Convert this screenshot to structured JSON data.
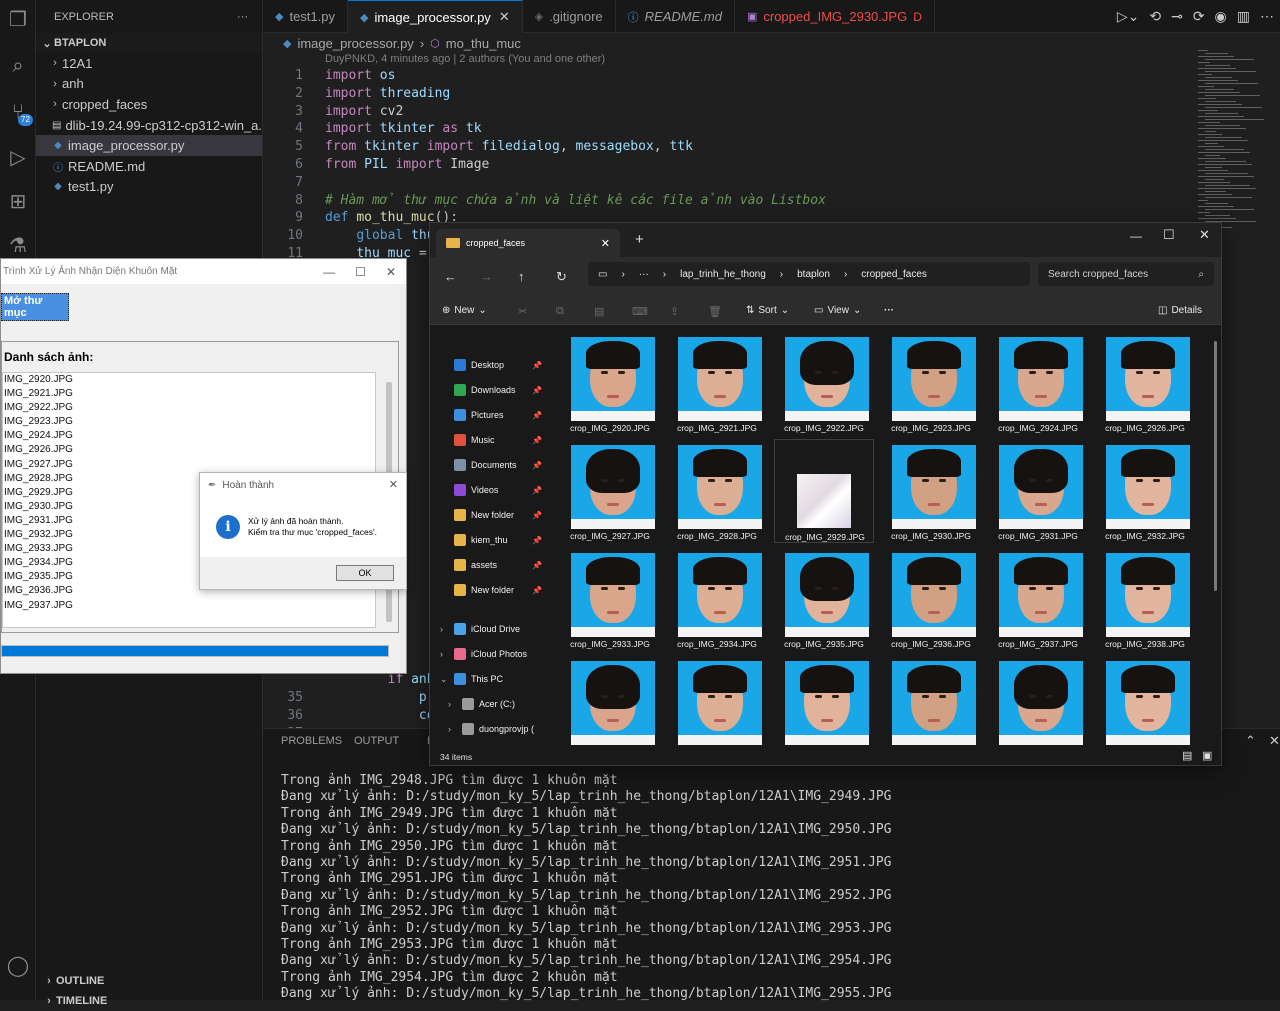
{
  "activity": {
    "scm_badge": "72"
  },
  "sidebar": {
    "header": "EXPLORER",
    "more": "···",
    "project": "BTAPLON",
    "items": [
      {
        "label": "12A1",
        "kind": "folder"
      },
      {
        "label": "anh",
        "kind": "folder"
      },
      {
        "label": "cropped_faces",
        "kind": "folder"
      },
      {
        "label": "dlib-19.24.99-cp312-cp312-win_a...",
        "kind": "file"
      },
      {
        "label": "image_processor.py",
        "kind": "py"
      },
      {
        "label": "README.md",
        "kind": "md"
      },
      {
        "label": "test1.py",
        "kind": "py"
      }
    ],
    "outline": "OUTLINE",
    "timeline": "TIMELINE"
  },
  "tabs": [
    {
      "label": "test1.py",
      "icon": "python-icon"
    },
    {
      "label": "image_processor.py",
      "icon": "python-icon"
    },
    {
      "label": ".gitignore",
      "icon": "git-icon"
    },
    {
      "label": "README.md",
      "icon": "info-icon"
    },
    {
      "label": "cropped_IMG_2930.JPG",
      "icon": "image-icon",
      "suffix": "D"
    }
  ],
  "breadcrumb": {
    "file": "image_processor.py",
    "symbol": "mo_thu_muc"
  },
  "blame": "DuyPNKD, 4 minutes ago | 2 authors (You and one other)",
  "code": [
    {
      "n": "1",
      "t": "import os"
    },
    {
      "n": "2",
      "t": "import threading"
    },
    {
      "n": "3",
      "t": "import cv2"
    },
    {
      "n": "4",
      "t": "import tkinter as tk"
    },
    {
      "n": "5",
      "t": "from tkinter import filedialog, messagebox, ttk"
    },
    {
      "n": "6",
      "t": "from PIL import Image"
    },
    {
      "n": "7",
      "t": ""
    },
    {
      "n": "8",
      "t": "# Hàm mở thư mục chứa ảnh và liệt kê các file ảnh vào Listbox"
    },
    {
      "n": "9",
      "t": "def mo_thu_muc():"
    },
    {
      "n": "10",
      "t": "    global thu"
    },
    {
      "n": "11",
      "t": "    thu_muc = "
    }
  ],
  "code_tail": [
    {
      "n": "35",
      "t": "            pr"
    },
    {
      "n": "36",
      "t": "            co"
    },
    {
      "n": "37",
      "t": ""
    }
  ],
  "code_tail_if": {
    "n": "34",
    "t": "        if anh"
  },
  "panel": {
    "tabs": [
      "PROBLEMS",
      "OUTPUT",
      "DE"
    ],
    "lines": [
      "Trong ảnh IMG_2948.JPG tìm được 1 khuôn mặt",
      "Đang xử lý ảnh: D:/study/mon_ky_5/lap_trinh_he_thong/btaplon/12A1\\IMG_2949.JPG",
      "Trong ảnh IMG_2949.JPG tìm được 1 khuôn mặt",
      "Đang xử lý ảnh: D:/study/mon_ky_5/lap_trinh_he_thong/btaplon/12A1\\IMG_2950.JPG",
      "Trong ảnh IMG_2950.JPG tìm được 1 khuôn mặt",
      "Đang xử lý ảnh: D:/study/mon_ky_5/lap_trinh_he_thong/btaplon/12A1\\IMG_2951.JPG",
      "Trong ảnh IMG_2951.JPG tìm được 1 khuôn mặt",
      "Đang xử lý ảnh: D:/study/mon_ky_5/lap_trinh_he_thong/btaplon/12A1\\IMG_2952.JPG",
      "Trong ảnh IMG_2952.JPG tìm được 1 khuôn mặt",
      "Đang xử lý ảnh: D:/study/mon_ky_5/lap_trinh_he_thong/btaplon/12A1\\IMG_2953.JPG",
      "Trong ảnh IMG_2953.JPG tìm được 1 khuôn mặt",
      "Đang xử lý ảnh: D:/study/mon_ky_5/lap_trinh_he_thong/btaplon/12A1\\IMG_2954.JPG",
      "Trong ảnh IMG_2954.JPG tìm được 2 khuôn mặt",
      "Đang xử lý ảnh: D:/study/mon_ky_5/lap_trinh_he_thong/btaplon/12A1\\IMG_2955.JPG"
    ]
  },
  "tkapp": {
    "title": "Trình Xử Lý Ảnh Nhận Diện Khuôn Mặt",
    "button": "Mở thư mục",
    "list_label": "Danh sách ảnh:",
    "files": [
      "IMG_2920.JPG",
      "IMG_2921.JPG",
      "IMG_2922.JPG",
      "IMG_2923.JPG",
      "IMG_2924.JPG",
      "IMG_2926.JPG",
      "IMG_2927.JPG",
      "IMG_2928.JPG",
      "IMG_2929.JPG",
      "IMG_2930.JPG",
      "IMG_2931.JPG",
      "IMG_2932.JPG",
      "IMG_2933.JPG",
      "IMG_2934.JPG",
      "IMG_2935.JPG",
      "IMG_2936.JPG",
      "IMG_2937.JPG"
    ],
    "progress_fraction": 1.0
  },
  "msgbox": {
    "title": "Hoàn thành",
    "line1": "Xử lý ảnh đã hoàn thành.",
    "line2": "Kiểm tra thư mục 'cropped_faces'.",
    "ok": "OK"
  },
  "explorer": {
    "tab_title": "cropped_faces",
    "path": [
      "···",
      "lap_trinh_he_thong",
      "btaplon",
      "cropped_faces"
    ],
    "search_placeholder": "Search cropped_faces",
    "new": "New",
    "sort": "Sort",
    "view": "View",
    "more": "···",
    "details": "Details",
    "nav": [
      {
        "label": "Desktop",
        "color": "#2b7bd6",
        "pinned": true
      },
      {
        "label": "Downloads",
        "color": "#2fa84f",
        "pinned": true
      },
      {
        "label": "Pictures",
        "color": "#3d8fe0",
        "pinned": true
      },
      {
        "label": "Music",
        "color": "#e0503d",
        "pinned": true
      },
      {
        "label": "Documents",
        "color": "#7d8fa8",
        "pinned": true
      },
      {
        "label": "Videos",
        "color": "#8c4bd6",
        "pinned": true
      },
      {
        "label": "New folder",
        "color": "#e8b44a",
        "pinned": true
      },
      {
        "label": "kiem_thu",
        "color": "#e8b44a",
        "pinned": true
      },
      {
        "label": "assets",
        "color": "#e8b44a",
        "pinned": true
      },
      {
        "label": "New folder",
        "color": "#e8b44a",
        "pinned": true
      },
      {
        "label": "iCloud Drive",
        "color": "#4aa3e8",
        "pinned": false
      },
      {
        "label": "iCloud Photos",
        "color": "#e86a8c",
        "pinned": false
      },
      {
        "label": "This PC",
        "color": "#3d8fe0",
        "pinned": false
      },
      {
        "label": "Acer (C:)",
        "color": "#9a9a9a",
        "pinned": false
      },
      {
        "label": "duongprovjp (",
        "color": "#9a9a9a",
        "pinned": false
      }
    ],
    "files": [
      "crop_IMG_2920.JPG",
      "crop_IMG_2921.JPG",
      "crop_IMG_2922.JPG",
      "crop_IMG_2923.JPG",
      "crop_IMG_2924.JPG",
      "crop_IMG_2926.JPG",
      "crop_IMG_2927.JPG",
      "crop_IMG_2928.JPG",
      "crop_IMG_2929.JPG",
      "crop_IMG_2930.JPG",
      "crop_IMG_2931.JPG",
      "crop_IMG_2932.JPG",
      "crop_IMG_2933.JPG",
      "crop_IMG_2934.JPG",
      "crop_IMG_2935.JPG",
      "crop_IMG_2936.JPG",
      "crop_IMG_2937.JPG",
      "crop_IMG_2938.JPG",
      "",
      "",
      "",
      "",
      "",
      ""
    ],
    "item_count": "34 items"
  }
}
